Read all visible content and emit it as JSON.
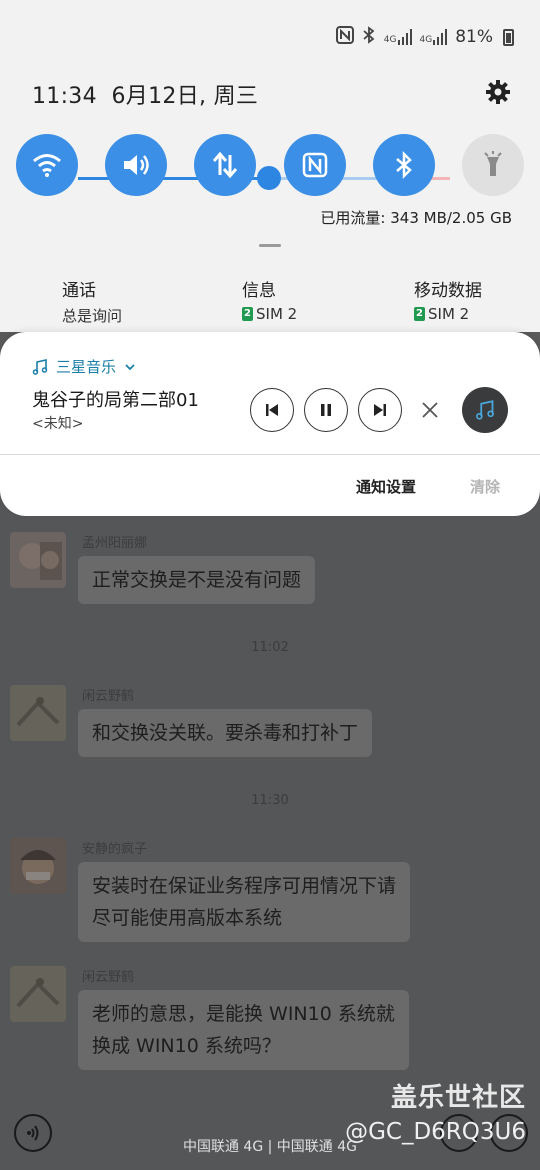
{
  "status_bar": {
    "battery_percent": "81%",
    "network_1": "4G",
    "network_2": "4G"
  },
  "header": {
    "time": "11:34",
    "date": "6月12日, 周三"
  },
  "quick_toggles": [
    {
      "name": "wifi",
      "on": true
    },
    {
      "name": "sound",
      "on": true
    },
    {
      "name": "mobile-data",
      "on": true
    },
    {
      "name": "nfc",
      "on": true
    },
    {
      "name": "bluetooth",
      "on": true
    },
    {
      "name": "flashlight",
      "on": false
    }
  ],
  "data_usage": "已用流量: 343 MB/2.05 GB",
  "sim_settings": [
    {
      "title": "通话",
      "value": "总是询问",
      "badge": ""
    },
    {
      "title": "信息",
      "value": "SIM 2",
      "badge": "2"
    },
    {
      "title": "移动数据",
      "value": "SIM 2",
      "badge": "2"
    }
  ],
  "media": {
    "app_name": "三星音乐",
    "song_title": "鬼谷子的局第二部01",
    "artist": "<未知>",
    "notif_settings_label": "通知设置",
    "clear_label": "清除"
  },
  "chat": {
    "messages": [
      {
        "sender": "孟州阳丽娜",
        "text_lines": [
          "正常交换是不是没有问题"
        ]
      },
      {
        "sender": "闲云野鹤",
        "text_lines": [
          "和交换没关联。要杀毒和打补丁"
        ]
      },
      {
        "sender": "安静的疯子",
        "text_lines": [
          "安装时在保证业务程序可用情况下请",
          "尽可能使用高版本系统"
        ]
      },
      {
        "sender": "闲云野鹤",
        "text_lines": [
          "老师的意思，是能换 WIN10 系统就",
          "换成 WIN10 系统吗？"
        ]
      }
    ],
    "timestamps": [
      "11:02",
      "11:30"
    ]
  },
  "carrier_text": "中国联通 4G | 中国联通 4G",
  "watermark": {
    "line1": "盖乐世社区",
    "line2": "@GC_D6RQ3U6"
  },
  "colors": {
    "accent": "#3b8fe6",
    "music_app": "#1b7fa8",
    "sim_badge": "#1f9a50"
  }
}
